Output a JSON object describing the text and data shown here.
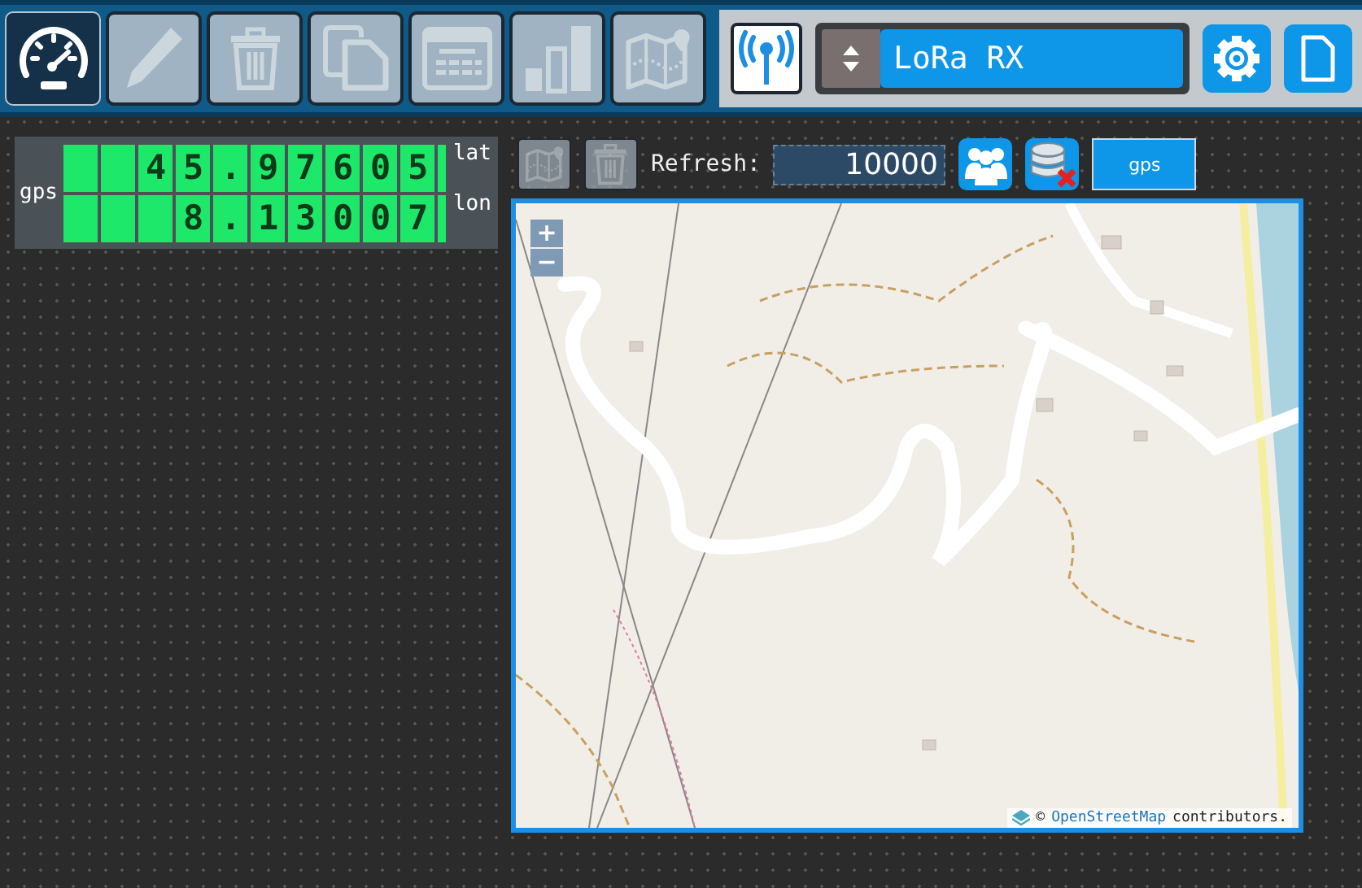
{
  "toolbar": {
    "tools": [
      {
        "kind": "gauge",
        "selected": true,
        "disabled": false
      },
      {
        "kind": "pencil",
        "selected": false,
        "disabled": true
      },
      {
        "kind": "trash",
        "selected": false,
        "disabled": true
      },
      {
        "kind": "copy",
        "selected": false,
        "disabled": true
      },
      {
        "kind": "table",
        "selected": false,
        "disabled": true
      },
      {
        "kind": "bars",
        "selected": false,
        "disabled": true
      },
      {
        "kind": "map",
        "selected": false,
        "disabled": true
      }
    ],
    "device": {
      "name": "LoRa RX"
    }
  },
  "gps_widget": {
    "label": "gps",
    "rows": [
      {
        "value": "45.97605",
        "unit": "lat"
      },
      {
        "value": "8.13007",
        "unit": "lon"
      }
    ]
  },
  "map_toolbar": {
    "refresh_label": "Refresh:",
    "refresh_value": "10000",
    "source_button": "gps",
    "map_disabled": true,
    "trash_disabled": true
  },
  "map": {
    "zoom_in": "+",
    "zoom_out": "−",
    "attribution_prefix": "©",
    "attribution_link": "OpenStreetMap",
    "attribution_suffix": "contributors."
  }
}
